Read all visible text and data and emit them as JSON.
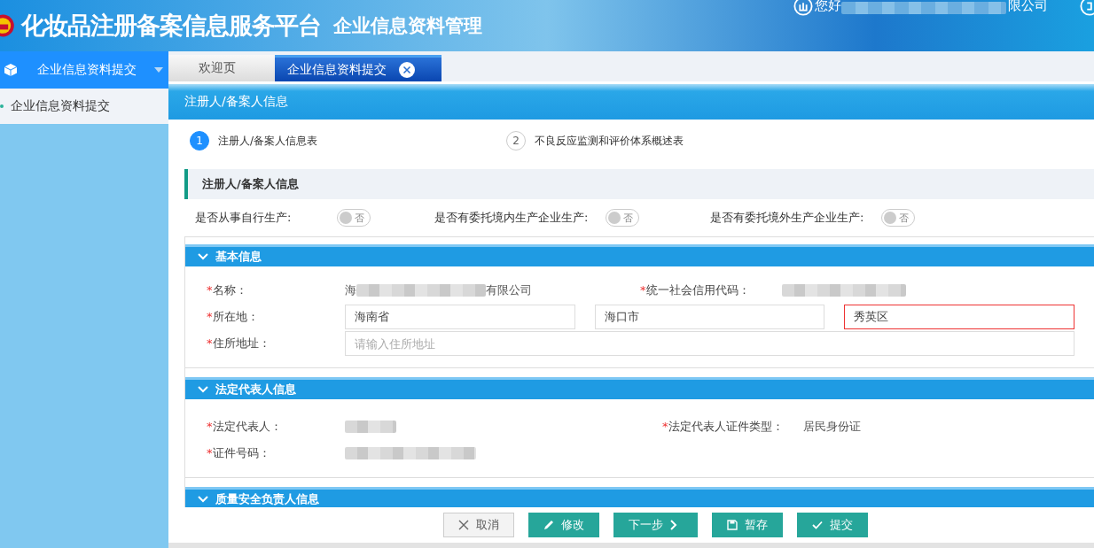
{
  "header": {
    "title": "化妆品注册备案信息服务平台",
    "subtitle": "企业信息资料管理",
    "greeting": "您好",
    "company_tail": "限公司"
  },
  "sidebar": {
    "menu": {
      "label": "企业信息资料提交",
      "expanded": true
    },
    "items": [
      {
        "label": "企业信息资料提交",
        "selected": true
      }
    ]
  },
  "tabs": [
    {
      "label": "欢迎页",
      "selected": false,
      "closable": false
    },
    {
      "label": "企业信息资料提交",
      "selected": true,
      "closable": true
    }
  ],
  "page_title": "注册人/备案人信息",
  "steps": [
    {
      "number": "1",
      "label": "注册人/备案人信息表",
      "selected": true
    },
    {
      "number": "2",
      "label": "不良反应监测和评价体系概述表",
      "selected": false
    }
  ],
  "section_title": "注册人/备案人信息",
  "toggles": [
    {
      "label": "是否从事自行生产:",
      "on": false,
      "text": "否"
    },
    {
      "label": "是否有委托境内生产企业生产:",
      "on": false,
      "text": "否"
    },
    {
      "label": "是否有委托境外生产企业生产:",
      "on": false,
      "text": "否"
    }
  ],
  "basic_info": {
    "title": "基本信息",
    "expanded": true,
    "name_label": {
      "mark": "*",
      "text": "名称："
    },
    "name_head": "海",
    "name_tail": "有限公司",
    "code_label": {
      "mark": "*",
      "text": "统一社会信用代码："
    },
    "location_label": {
      "mark": "*",
      "text": "所在地："
    },
    "province": "海南省",
    "city": "海口市",
    "district": "秀英区",
    "district_error": true,
    "address_label": {
      "mark": "*",
      "text": "住所地址："
    },
    "address_placeholder": "请输入住所地址"
  },
  "legal_rep": {
    "title": "法定代表人信息",
    "expanded": true,
    "rep_label": {
      "mark": "*",
      "text": "法定代表人："
    },
    "id_type_label": {
      "mark": "*",
      "text": "法定代表人证件类型："
    },
    "id_type": "居民身份证",
    "id_number_label": {
      "mark": "*",
      "text": "证件号码："
    }
  },
  "quality_section": {
    "title": "质量安全负责人信息",
    "expanded": true
  },
  "buttons": [
    {
      "kind": "cancel",
      "label": "取消"
    },
    {
      "kind": "edit",
      "label": "修改"
    },
    {
      "kind": "next",
      "label": "下一步"
    },
    {
      "kind": "save",
      "label": "暂存"
    },
    {
      "kind": "submit",
      "label": "提交"
    }
  ]
}
